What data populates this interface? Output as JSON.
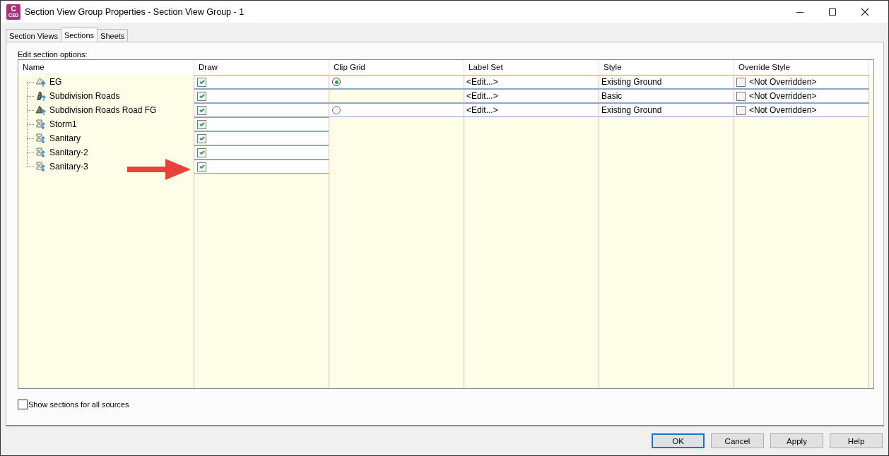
{
  "window": {
    "title": "Section View Group Properties - Section View Group - 1",
    "app_icon_letter": "C",
    "app_icon_sub": "C3D"
  },
  "tabs": [
    {
      "label": "Section Views",
      "selected": false
    },
    {
      "label": "Sections",
      "selected": true
    },
    {
      "label": "Sheets",
      "selected": false
    }
  ],
  "group_label": "Edit section options:",
  "table": {
    "columns": [
      "Name",
      "Draw",
      "Clip Grid",
      "Label Set",
      "Style",
      "Override Style"
    ],
    "rows": [
      {
        "name": "EG",
        "kind": "surface",
        "draw": true,
        "clip_grid": {
          "selected": true
        },
        "label_set": "<Edit...>",
        "style": "Existing Ground",
        "override": {
          "checked": false,
          "text": "<Not Overridden>"
        }
      },
      {
        "name": "Subdivision Roads",
        "kind": "corridor",
        "draw": true,
        "label_set": "<Edit...>",
        "style": "Basic",
        "override": {
          "checked": false,
          "text": "<Not Overridden>"
        }
      },
      {
        "name": "Subdivision Roads Road FG",
        "kind": "corridor-surface",
        "draw": true,
        "clip_grid": {
          "selected": false
        },
        "label_set": "<Edit...>",
        "style": "Existing Ground",
        "override": {
          "checked": false,
          "text": "<Not Overridden>"
        }
      },
      {
        "name": "Storm1",
        "kind": "pipe-network",
        "draw": true
      },
      {
        "name": "Sanitary",
        "kind": "pipe-network",
        "draw": true
      },
      {
        "name": "Sanitary-2",
        "kind": "pipe-network",
        "draw": true
      },
      {
        "name": "Sanitary-3",
        "kind": "pipe-network",
        "draw": true
      }
    ]
  },
  "show_all_sources": {
    "label": "Show sections for all sources",
    "checked": false
  },
  "buttons": [
    {
      "label": "OK",
      "focused": true
    },
    {
      "label": "Cancel",
      "focused": false
    },
    {
      "label": "Apply",
      "focused": false
    },
    {
      "label": "Help",
      "focused": false
    }
  ]
}
